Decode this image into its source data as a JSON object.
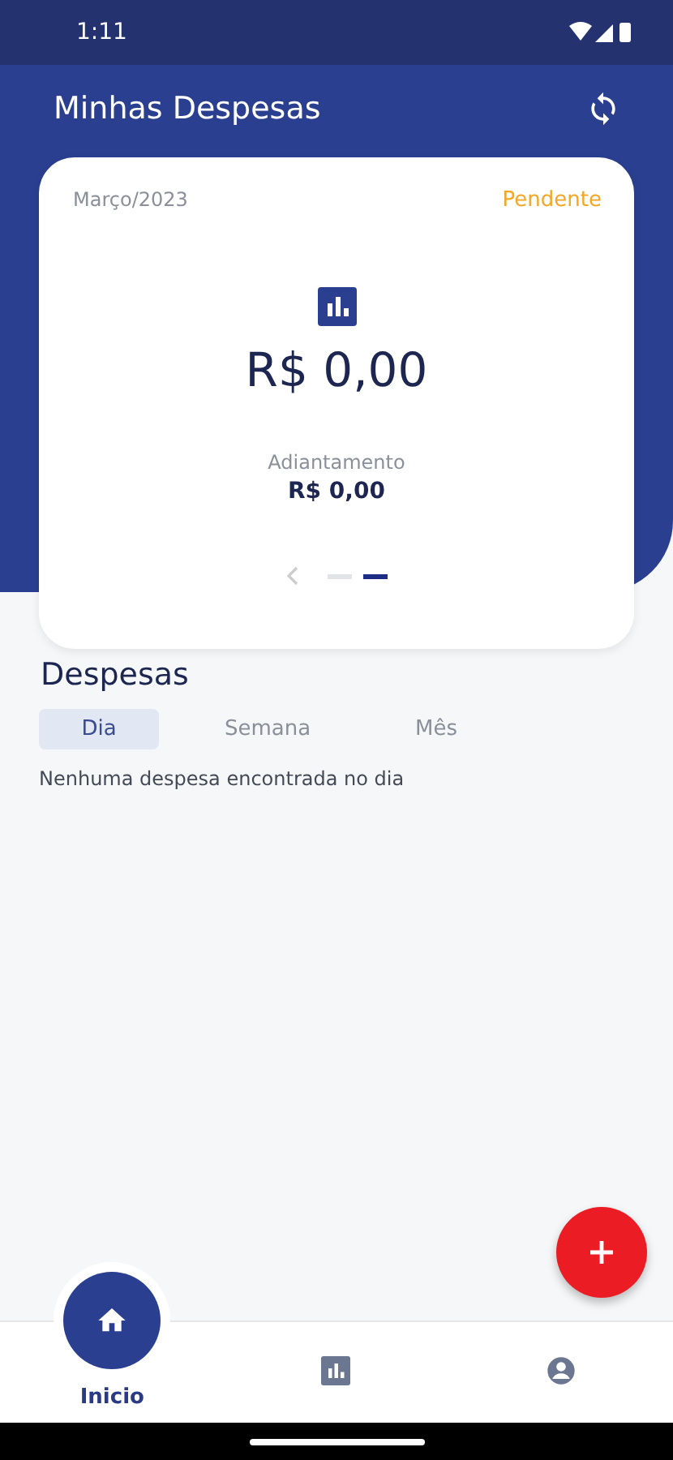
{
  "status_bar": {
    "time": "1:11"
  },
  "header": {
    "title": "Minhas Despesas"
  },
  "summary_card": {
    "period": "Março/2023",
    "status": "Pendente",
    "total": "R$ 0,00",
    "advance_label": "Adiantamento",
    "advance_value": "R$ 0,00",
    "pages": [
      {
        "selected": false
      },
      {
        "selected": true
      }
    ]
  },
  "expenses": {
    "title": "Despesas",
    "tabs": [
      {
        "label": "Dia",
        "selected": true
      },
      {
        "label": "Semana",
        "selected": false
      },
      {
        "label": "Mês",
        "selected": false
      }
    ],
    "empty_message": "Nenhuma despesa encontrada no dia"
  },
  "bottom_nav": [
    {
      "kind": "home",
      "label": "Inicio",
      "selected": true
    },
    {
      "kind": "chart",
      "selected": false
    },
    {
      "kind": "profile",
      "selected": false
    }
  ]
}
